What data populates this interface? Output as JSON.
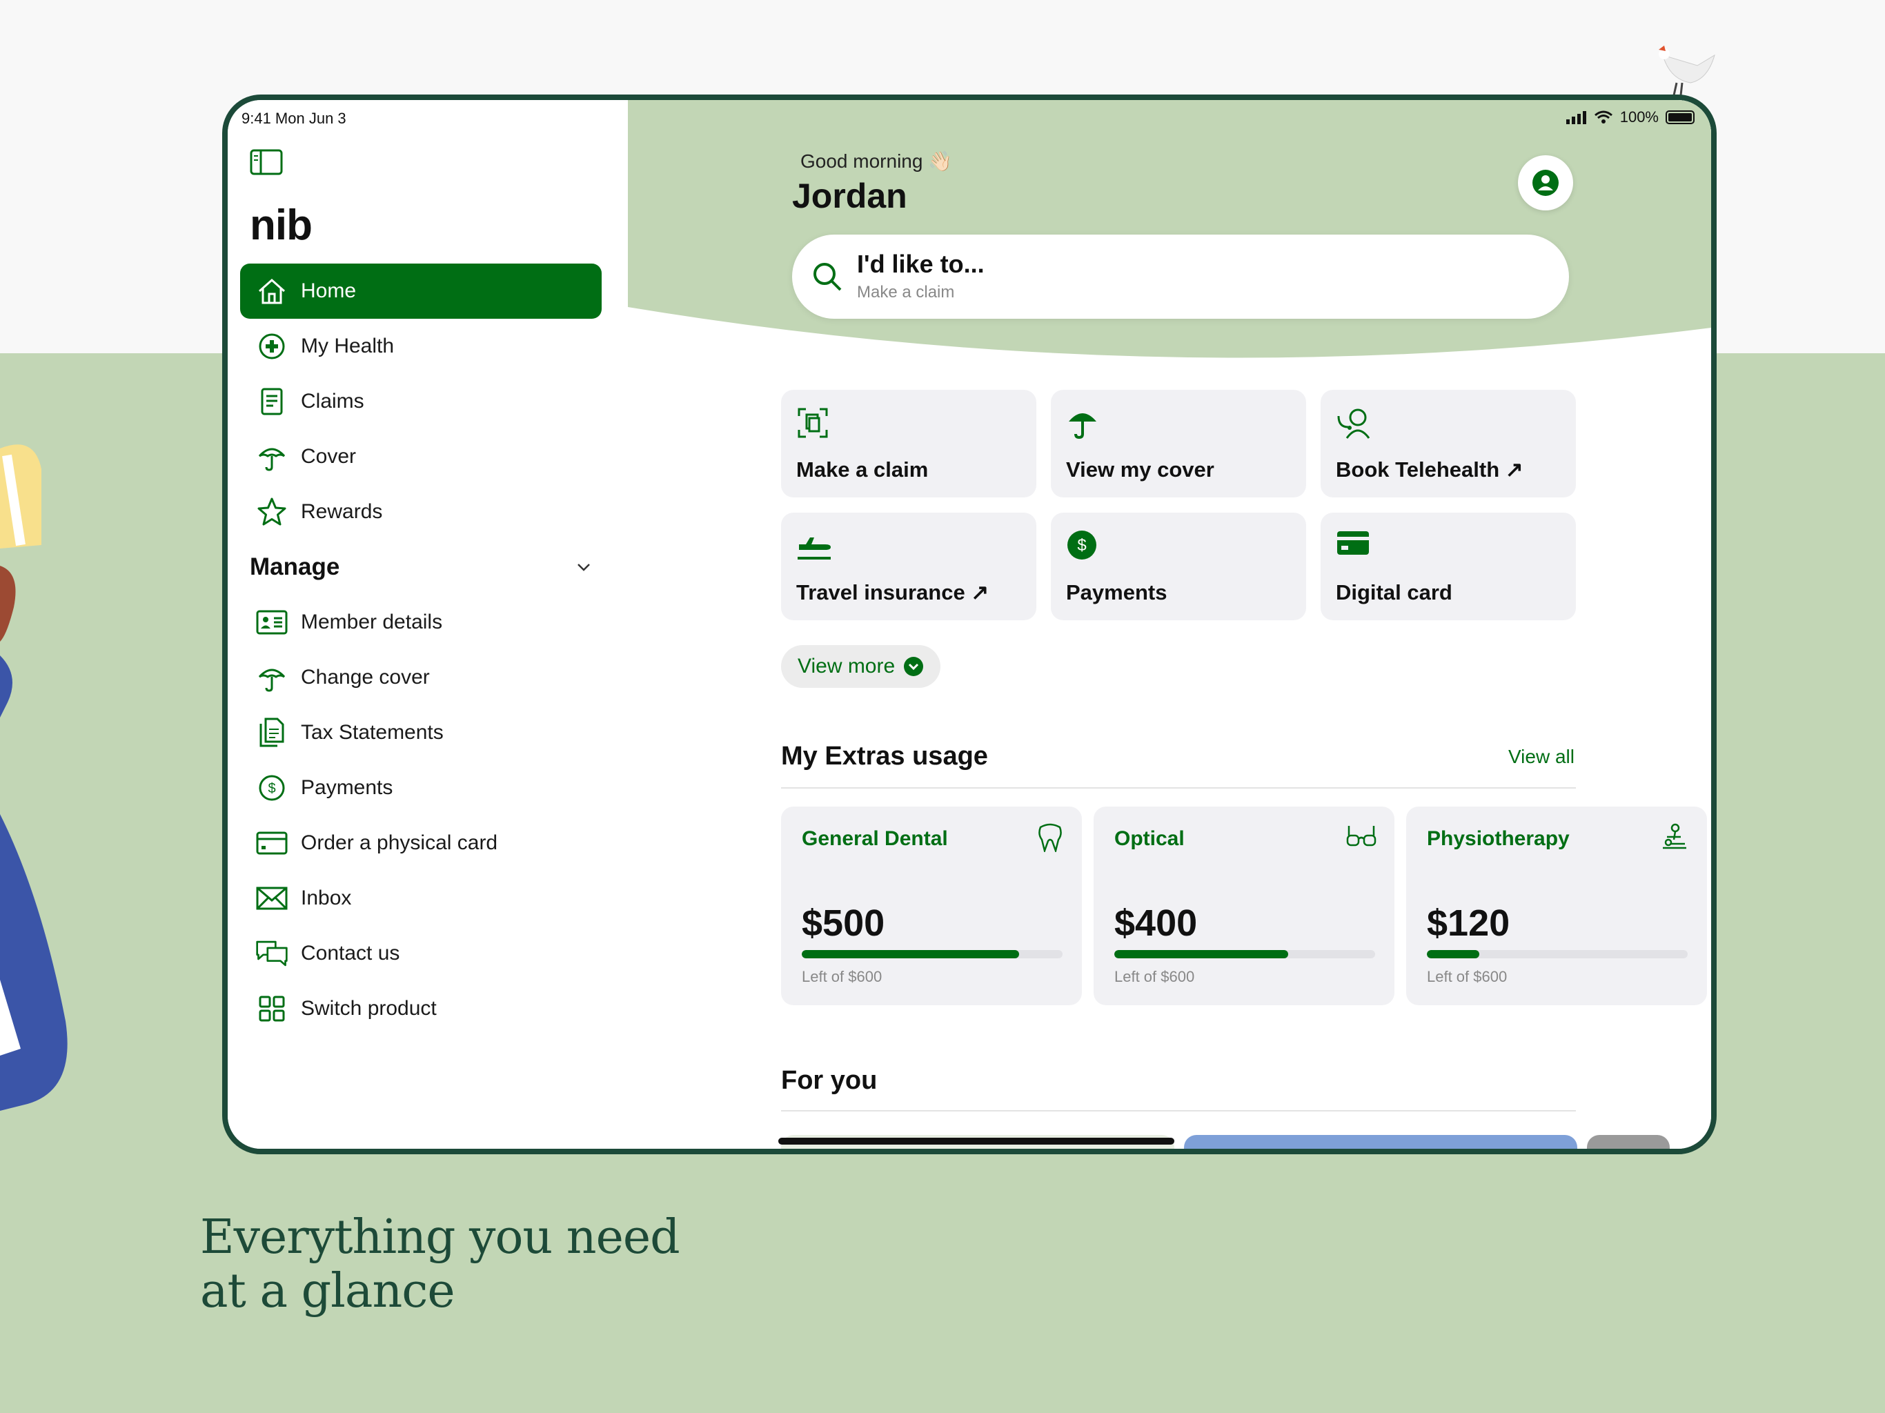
{
  "marketing": {
    "tagline_line1": "Everything you need",
    "tagline_line2": "at a glance"
  },
  "status_bar": {
    "time": "9:41 Mon Jun 3",
    "battery": "100%"
  },
  "sidebar": {
    "brand": "nib",
    "items": [
      {
        "label": "Home",
        "icon": "home-icon",
        "active": true
      },
      {
        "label": "My Health",
        "icon": "health-plus-icon"
      },
      {
        "label": "Claims",
        "icon": "document-icon"
      },
      {
        "label": "Cover",
        "icon": "umbrella-icon"
      },
      {
        "label": "Rewards",
        "icon": "star-icon"
      }
    ],
    "manage_heading": "Manage",
    "manage_items": [
      {
        "label": "Member details",
        "icon": "id-card-icon"
      },
      {
        "label": "Change cover",
        "icon": "umbrella-icon"
      },
      {
        "label": "Tax Statements",
        "icon": "files-icon"
      },
      {
        "label": "Payments",
        "icon": "dollar-circle-icon"
      },
      {
        "label": "Order a physical card",
        "icon": "card-icon"
      },
      {
        "label": "Inbox",
        "icon": "mail-icon"
      },
      {
        "label": "Contact us",
        "icon": "chat-icon"
      },
      {
        "label": "Switch product",
        "icon": "grid-icon"
      }
    ]
  },
  "header": {
    "greeting": "Good morning 👋🏻",
    "name": "Jordan",
    "search_title": "I'd like to...",
    "search_subtitle": "Make a claim"
  },
  "quick_actions": [
    {
      "label": "Make a claim",
      "icon": "scan-claim-icon"
    },
    {
      "label": "View my cover",
      "icon": "umbrella-icon"
    },
    {
      "label": "Book Telehealth ↗",
      "icon": "telehealth-icon"
    },
    {
      "label": "Travel insurance ↗",
      "icon": "plane-icon"
    },
    {
      "label": "Payments",
      "icon": "dollar-circle-icon"
    },
    {
      "label": "Digital card",
      "icon": "card-icon"
    }
  ],
  "view_more": "View more",
  "extras": {
    "title": "My Extras usage",
    "view_all": "View all",
    "items": [
      {
        "name": "General Dental",
        "amount": "$500",
        "remaining_fraction": 0.8333,
        "left": "Left of $600",
        "icon": "tooth-icon"
      },
      {
        "name": "Optical",
        "amount": "$400",
        "remaining_fraction": 0.6667,
        "left": "Left of $600",
        "icon": "glasses-icon"
      },
      {
        "name": "Physiotherapy",
        "amount": "$120",
        "remaining_fraction": 0.2,
        "left": "Left of $600",
        "icon": "physio-icon"
      }
    ]
  },
  "for_you": {
    "title": "For you"
  },
  "colors": {
    "brand_green": "#006e14",
    "hero_green": "#c2d6b5",
    "frame": "#1c4a39"
  }
}
